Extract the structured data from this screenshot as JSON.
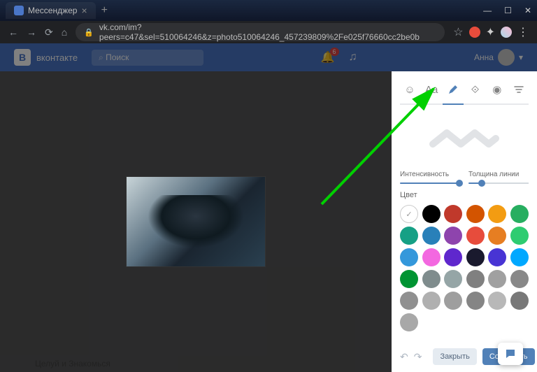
{
  "titlebar": {
    "tab_title": "Мессенджер"
  },
  "addrbar": {
    "url": "vk.com/im?peers=c47&sel=510064246&z=photo510064246_457239809%2Fe025f76660cc2be0b"
  },
  "vk": {
    "brand": "вконтакте",
    "logo_letter": "B",
    "search_placeholder": "Поиск",
    "notif_count": "6",
    "user_name": "Анна"
  },
  "editor": {
    "intensity_label": "Интенсивность",
    "thickness_label": "Толщина линии",
    "color_label": "Цвет",
    "close_btn": "Закрыть",
    "save_btn": "Сохранить",
    "colors": [
      "#000000",
      "#c0392b",
      "#d35400",
      "#f39c12",
      "#27ae60",
      "#16a085",
      "#2980b9",
      "#8e44ad",
      "#e74c3c",
      "#e67e22",
      "#2ecc71",
      "#3498db",
      "#f368e0",
      "#5f27cd",
      "#1a1a2e",
      "#4834d4",
      "#00a8ff",
      "#009432",
      "#7f8c8d",
      "#95a5a6",
      "#808080",
      "#a0a0a0",
      "#888888",
      "#909090",
      "#b0b0b0",
      "#9e9e9e",
      "#858585",
      "#b8b8b8",
      "#787878",
      "#a8a8a8"
    ]
  },
  "sidebar": {
    "item": "Целуй и Знакомься"
  }
}
